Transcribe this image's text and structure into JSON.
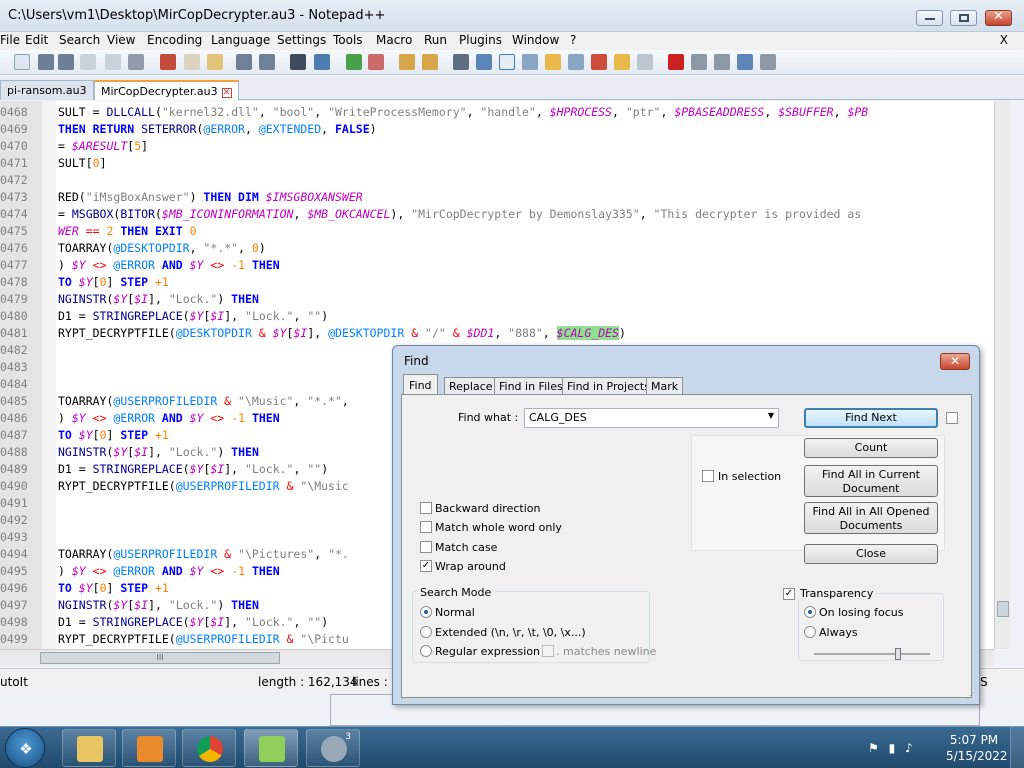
{
  "window": {
    "title": "C:\\Users\\vm1\\Desktop\\MirCopDecrypter.au3 - Notepad++",
    "minimize_label": "",
    "maximize_label": "",
    "close_label": "X"
  },
  "menu": {
    "items": [
      "File",
      "Edit",
      "Search",
      "View",
      "Encoding",
      "Language",
      "Settings",
      "Tools",
      "Macro",
      "Run",
      "Plugins",
      "Window",
      "?"
    ],
    "close_doc": "X"
  },
  "tabs": [
    {
      "label": "pi-ransom.au3",
      "active": false
    },
    {
      "label": "MirCopDecrypter.au3",
      "active": true
    }
  ],
  "editor": {
    "lines": [
      {
        "n": "0468",
        "parts": [
          [
            "",
            "SULT = "
          ],
          [
            "fn",
            "DLLCALL"
          ],
          [
            "",
            "("
          ],
          [
            "str",
            "\"kernel32.dll\""
          ],
          [
            "",
            ", "
          ],
          [
            "str",
            "\"bool\""
          ],
          [
            "",
            ", "
          ],
          [
            "str",
            "\"WriteProcessMemory\""
          ],
          [
            "",
            ", "
          ],
          [
            "str",
            "\"handle\""
          ],
          [
            "",
            ", "
          ],
          [
            "var",
            "$HPROCESS"
          ],
          [
            "",
            ", "
          ],
          [
            "str",
            "\"ptr\""
          ],
          [
            "",
            ", "
          ],
          [
            "var",
            "$PBASEADDRESS"
          ],
          [
            "",
            ", "
          ],
          [
            "var",
            "$SBUFFER"
          ],
          [
            "",
            ", "
          ],
          [
            "var",
            "$PB"
          ]
        ]
      },
      {
        "n": "0469",
        "parts": [
          [
            "kw",
            "THEN RETURN"
          ],
          [
            "",
            ""
          ],
          [
            "fn",
            " SETERROR"
          ],
          [
            "",
            "("
          ],
          [
            "mac",
            "@ERROR"
          ],
          [
            "",
            ", "
          ],
          [
            "mac",
            "@EXTENDED"
          ],
          [
            "",
            ", "
          ],
          [
            "kw",
            "FALSE"
          ],
          [
            "",
            ")"
          ]
        ]
      },
      {
        "n": "0470",
        "parts": [
          [
            "",
            "= "
          ],
          [
            "var",
            "$ARESULT"
          ],
          [
            "",
            "["
          ],
          [
            "num",
            "5"
          ],
          [
            "",
            "]"
          ]
        ]
      },
      {
        "n": "0471",
        "parts": [
          [
            "",
            "SULT["
          ],
          [
            "num",
            "0"
          ],
          [
            "",
            "]"
          ]
        ]
      },
      {
        "n": "0472",
        "parts": []
      },
      {
        "n": "0473",
        "parts": [
          [
            "",
            "RED("
          ],
          [
            "str",
            "\"iMsgBoxAnswer\""
          ],
          [
            "",
            ") "
          ],
          [
            "kw",
            "THEN DIM"
          ],
          [
            "",
            ""
          ],
          [
            "var",
            " $IMSGBOXANSWER"
          ]
        ]
      },
      {
        "n": "0474",
        "parts": [
          [
            "",
            "= "
          ],
          [
            "fn",
            "MSGBOX"
          ],
          [
            "",
            "("
          ],
          [
            "fn",
            "BITOR"
          ],
          [
            "",
            "("
          ],
          [
            "var",
            "$MB_ICONINFORMATION"
          ],
          [
            "",
            ", "
          ],
          [
            "var",
            "$MB_OKCANCEL"
          ],
          [
            "",
            "), "
          ],
          [
            "str",
            "\"MirCopDecrypter by Demonslay335\""
          ],
          [
            "",
            ", "
          ],
          [
            "str",
            "\"This decrypter is provided as"
          ]
        ]
      },
      {
        "n": "0475",
        "parts": [
          [
            "var",
            "WER"
          ],
          [
            "",
            ""
          ],
          [
            "op",
            " == "
          ],
          [
            "num",
            "2"
          ],
          [
            "kw",
            " THEN EXIT"
          ],
          [
            "num",
            " 0"
          ]
        ]
      },
      {
        "n": "0476",
        "parts": [
          [
            "",
            "TOARRAY("
          ],
          [
            "mac",
            "@DESKTOPDIR"
          ],
          [
            "",
            ", "
          ],
          [
            "str",
            "\"*.*\""
          ],
          [
            "",
            ", "
          ],
          [
            "num",
            "0"
          ],
          [
            "",
            ")"
          ]
        ]
      },
      {
        "n": "0477",
        "parts": [
          [
            "",
            ") "
          ],
          [
            "var",
            "$Y"
          ],
          [
            "op",
            " <> "
          ],
          [
            "mac",
            "@ERROR"
          ],
          [
            "kw",
            " AND"
          ],
          [
            "var",
            " $Y"
          ],
          [
            "op",
            " <> "
          ],
          [
            "num",
            "-1"
          ],
          [
            "kw",
            " THEN"
          ]
        ]
      },
      {
        "n": "0478",
        "parts": [
          [
            "kw",
            " TO"
          ],
          [
            "var",
            " $Y"
          ],
          [
            "",
            "["
          ],
          [
            "num",
            "0"
          ],
          [
            "",
            "] "
          ],
          [
            "kw",
            "STEP"
          ],
          [
            "num",
            " +1"
          ]
        ]
      },
      {
        "n": "0479",
        "parts": [
          [
            "fn",
            "NGINSTR"
          ],
          [
            "",
            "("
          ],
          [
            "var",
            "$Y"
          ],
          [
            "",
            "["
          ],
          [
            "var",
            "$I"
          ],
          [
            "",
            "], "
          ],
          [
            "str",
            "\"Lock.\""
          ],
          [
            "",
            ") "
          ],
          [
            "kw",
            "THEN"
          ]
        ]
      },
      {
        "n": "0480",
        "parts": [
          [
            "",
            "D1 = "
          ],
          [
            "fn",
            "STRINGREPLACE"
          ],
          [
            "",
            "("
          ],
          [
            "var",
            "$Y"
          ],
          [
            "",
            "["
          ],
          [
            "var",
            "$I"
          ],
          [
            "",
            "], "
          ],
          [
            "str",
            "\"Lock.\""
          ],
          [
            "",
            ", "
          ],
          [
            "str",
            "\"\""
          ],
          [
            "",
            ")"
          ]
        ]
      },
      {
        "n": "0481",
        "parts": [
          [
            "",
            "RYPT_DECRYPTFILE("
          ],
          [
            "mac",
            "@DESKTOPDIR"
          ],
          [
            "op",
            " & "
          ],
          [
            "var",
            "$Y"
          ],
          [
            "",
            "["
          ],
          [
            "var",
            "$I"
          ],
          [
            "",
            "], "
          ],
          [
            "mac",
            "@DESKTOPDIR"
          ],
          [
            "op",
            " & "
          ],
          [
            "str",
            "\"/\""
          ],
          [
            "op",
            " & "
          ],
          [
            "var",
            "$DD1"
          ],
          [
            "",
            ", "
          ],
          [
            "str",
            "\"888\""
          ],
          [
            "",
            ", "
          ],
          [
            "var hl",
            "$CALG_DES"
          ],
          [
            "",
            ")"
          ]
        ]
      },
      {
        "n": "0482",
        "parts": []
      },
      {
        "n": "0483",
        "parts": []
      },
      {
        "n": "0484",
        "parts": []
      },
      {
        "n": "0485",
        "parts": [
          [
            "",
            "TOARRAY("
          ],
          [
            "mac",
            "@USERPROFILEDIR"
          ],
          [
            "op",
            " & "
          ],
          [
            "str",
            "\"\\Music\""
          ],
          [
            "",
            ", "
          ],
          [
            "str",
            "\"*.*\""
          ],
          [
            "",
            ","
          ]
        ]
      },
      {
        "n": "0486",
        "parts": [
          [
            "",
            ") "
          ],
          [
            "var",
            "$Y"
          ],
          [
            "op",
            " <> "
          ],
          [
            "mac",
            "@ERROR"
          ],
          [
            "kw",
            " AND"
          ],
          [
            "var",
            " $Y"
          ],
          [
            "op",
            " <> "
          ],
          [
            "num",
            "-1"
          ],
          [
            "kw",
            " THEN"
          ]
        ]
      },
      {
        "n": "0487",
        "parts": [
          [
            "kw",
            " TO"
          ],
          [
            "var",
            " $Y"
          ],
          [
            "",
            "["
          ],
          [
            "num",
            "0"
          ],
          [
            "",
            "] "
          ],
          [
            "kw",
            "STEP"
          ],
          [
            "num",
            " +1"
          ]
        ]
      },
      {
        "n": "0488",
        "parts": [
          [
            "fn",
            "NGINSTR"
          ],
          [
            "",
            "("
          ],
          [
            "var",
            "$Y"
          ],
          [
            "",
            "["
          ],
          [
            "var",
            "$I"
          ],
          [
            "",
            "], "
          ],
          [
            "str",
            "\"Lock.\""
          ],
          [
            "",
            ") "
          ],
          [
            "kw",
            "THEN"
          ]
        ]
      },
      {
        "n": "0489",
        "parts": [
          [
            "",
            "D1 = "
          ],
          [
            "fn",
            "STRINGREPLACE"
          ],
          [
            "",
            "("
          ],
          [
            "var",
            "$Y"
          ],
          [
            "",
            "["
          ],
          [
            "var",
            "$I"
          ],
          [
            "",
            "], "
          ],
          [
            "str",
            "\"Lock.\""
          ],
          [
            "",
            ", "
          ],
          [
            "str",
            "\"\""
          ],
          [
            "",
            ")"
          ]
        ]
      },
      {
        "n": "0490",
        "parts": [
          [
            "",
            "RYPT_DECRYPTFILE("
          ],
          [
            "mac",
            "@USERPROFILEDIR"
          ],
          [
            "op",
            " & "
          ],
          [
            "str",
            "\"\\Music"
          ]
        ]
      },
      {
        "n": "0491",
        "parts": []
      },
      {
        "n": "0492",
        "parts": []
      },
      {
        "n": "0493",
        "parts": []
      },
      {
        "n": "0494",
        "parts": [
          [
            "",
            "TOARRAY("
          ],
          [
            "mac",
            "@USERPROFILEDIR"
          ],
          [
            "op",
            " & "
          ],
          [
            "str",
            "\"\\Pictures\""
          ],
          [
            "",
            ", "
          ],
          [
            "str",
            "\"*."
          ]
        ]
      },
      {
        "n": "0495",
        "parts": [
          [
            "",
            ") "
          ],
          [
            "var",
            "$Y"
          ],
          [
            "op",
            " <> "
          ],
          [
            "mac",
            "@ERROR"
          ],
          [
            "kw",
            " AND"
          ],
          [
            "var",
            " $Y"
          ],
          [
            "op",
            " <> "
          ],
          [
            "num",
            "-1"
          ],
          [
            "kw",
            " THEN"
          ]
        ]
      },
      {
        "n": "0496",
        "parts": [
          [
            "kw",
            " TO"
          ],
          [
            "var",
            " $Y"
          ],
          [
            "",
            "["
          ],
          [
            "num",
            "0"
          ],
          [
            "",
            "] "
          ],
          [
            "kw",
            "STEP"
          ],
          [
            "num",
            " +1"
          ]
        ]
      },
      {
        "n": "0497",
        "parts": [
          [
            "fn",
            "NGINSTR"
          ],
          [
            "",
            "("
          ],
          [
            "var",
            "$Y"
          ],
          [
            "",
            "["
          ],
          [
            "var",
            "$I"
          ],
          [
            "",
            "], "
          ],
          [
            "str",
            "\"Lock.\""
          ],
          [
            "",
            ") "
          ],
          [
            "kw",
            "THEN"
          ]
        ]
      },
      {
        "n": "0498",
        "parts": [
          [
            "",
            "D1 = "
          ],
          [
            "fn",
            "STRINGREPLACE"
          ],
          [
            "",
            "("
          ],
          [
            "var",
            "$Y"
          ],
          [
            "",
            "["
          ],
          [
            "var",
            "$I"
          ],
          [
            "",
            "], "
          ],
          [
            "str",
            "\"Lock.\""
          ],
          [
            "",
            ", "
          ],
          [
            "str",
            "\"\""
          ],
          [
            "",
            ")"
          ]
        ]
      },
      {
        "n": "0499",
        "parts": [
          [
            "",
            "RYPT_DECRYPTFILE("
          ],
          [
            "mac",
            "@USERPROFILEDIR"
          ],
          [
            "op",
            " & "
          ],
          [
            "str",
            "\"\\Pictu"
          ]
        ]
      }
    ],
    "hscroll_grip": "III"
  },
  "statusbar": {
    "lang": "utoIt",
    "length": "length : 162,134",
    "lines": "lines : 3",
    "right": "S"
  },
  "find_dialog": {
    "title": "Find",
    "close_label": "X",
    "tabs": [
      "Find",
      "Replace",
      "Find in Files",
      "Find in Projects",
      "Mark"
    ],
    "find_what_label": "Find what :",
    "find_what_value": "CALG_DES",
    "buttons": {
      "find_next": "Find Next",
      "count": "Count",
      "find_all_current": "Find All in Current Document",
      "find_all_opened": "Find All in All Opened Documents",
      "close": "Close"
    },
    "in_selection": "In selection",
    "options": {
      "backward": "Backward direction",
      "whole_word": "Match whole word only",
      "match_case": "Match case",
      "wrap_around": "Wrap around"
    },
    "search_mode": {
      "title": "Search Mode",
      "normal": "Normal",
      "extended": "Extended (\\n, \\r, \\t, \\0, \\x...)",
      "regex": "Regular expression",
      "matches_newline": ". matches newline"
    },
    "transparency": {
      "title": "Transparency",
      "on_losing_focus": "On losing focus",
      "always": "Always",
      "level": 0.7
    }
  },
  "taskbar": {
    "time": "5:07 PM",
    "date": "5/15/2022",
    "badge": "3"
  }
}
